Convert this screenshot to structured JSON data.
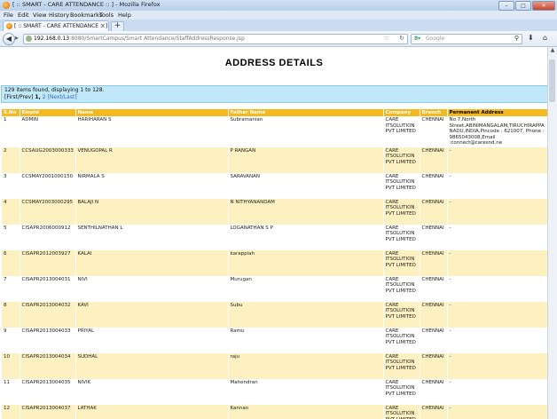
{
  "window": {
    "title": "[ :: SMART - CARE ATTENDANCE :: ] - Mozilla Firefox"
  },
  "menu": [
    "File",
    "Edit",
    "View",
    "History",
    "Bookmarks",
    "Tools",
    "Help"
  ],
  "tab": {
    "label": "[ :: SMART - CARE ATTENDANCE :: ]"
  },
  "address": {
    "host": "192.168.0.13",
    "path": ":8080/SmartCampus/Smart Attendance/StaffAddressResponse.jsp"
  },
  "search": {
    "placeholder": "Google"
  },
  "page": {
    "title": "ADDRESS DETAILS",
    "info_line": "129 items found, displaying 1 to 128.",
    "pager_first": "[First/Prev]",
    "pager_current": "1,",
    "pager_page2": "2",
    "pager_next": "[Next/Last]"
  },
  "table": {
    "headers": [
      "S.No",
      "EmpId",
      "Name",
      "Father Name",
      "Company",
      "Branch",
      "Permanent Address"
    ],
    "rows": [
      {
        "sno": "1",
        "empid": "ADMIN",
        "name": "HARIHARAN S",
        "father": "Subramanian",
        "company": "CARE ITSOLUTION PVT LIMITED",
        "branch": "CHENNAI",
        "address": "No 7,North Street,ABINIMANGALAM,TIRUCHIRAPPA NADU,INDIA,Pincode : 621007, Phone : 9865043008,Email :connect@caresnd.ne"
      },
      {
        "sno": "2",
        "empid": "CCSAUG2003000333",
        "name": "VENUGOPAL R",
        "father": "P RANGAN",
        "company": "CARE ITSOLUTION PVT LIMITED",
        "branch": "CHENNAI",
        "address": "-"
      },
      {
        "sno": "3",
        "empid": "CCSMAY2001000150",
        "name": "NIRMALA S",
        "father": "SARAVANAN",
        "company": "CARE ITSOLUTION PVT LIMITED",
        "branch": "CHENNAI",
        "address": "-"
      },
      {
        "sno": "4",
        "empid": "CCSMAY2003000295",
        "name": "BALAJI N",
        "father": "N NITHYANANDAM",
        "company": "CARE ITSOLUTION PVT LIMITED",
        "branch": "CHENNAI",
        "address": "-"
      },
      {
        "sno": "5",
        "empid": "CISAPR2006000912",
        "name": "SENTHILNATHAN L",
        "father": "LOGANATHAN S P",
        "company": "CARE ITSOLUTION PVT LIMITED",
        "branch": "CHENNAI",
        "address": "-"
      },
      {
        "sno": "6",
        "empid": "CISAPR2012003927",
        "name": "KALAI",
        "father": "karappiah",
        "company": "CARE ITSOLUTION PVT LIMITED",
        "branch": "CHENNAI",
        "address": "-"
      },
      {
        "sno": "7",
        "empid": "CISAPR2013004031",
        "name": "NIVI",
        "father": "Murugan",
        "company": "CARE ITSOLUTION PVT LIMITED",
        "branch": "CHENNAI",
        "address": "-"
      },
      {
        "sno": "8",
        "empid": "CISAPR2013004032",
        "name": "KAVI",
        "father": "Subu",
        "company": "CARE ITSOLUTION PVT LIMITED",
        "branch": "CHENNAI",
        "address": "-"
      },
      {
        "sno": "9",
        "empid": "CISAPR2013004033",
        "name": "PRIYAL",
        "father": "Ramu",
        "company": "CARE ITSOLUTION PVT LIMITED",
        "branch": "CHENNAI",
        "address": "-"
      },
      {
        "sno": "10",
        "empid": "CISAPR2013004034",
        "name": "SUDHAL",
        "father": "raju",
        "company": "CARE ITSOLUTION PVT LIMITED",
        "branch": "CHENNAI",
        "address": "-"
      },
      {
        "sno": "11",
        "empid": "CISAPR2013004035",
        "name": "NIVIK",
        "father": "Mahendran",
        "company": "CARE ITSOLUTION PVT LIMITED",
        "branch": "CHENNAI",
        "address": "-"
      },
      {
        "sno": "12",
        "empid": "CISAPR2013004037",
        "name": "LATHAK",
        "father": "Kannan",
        "company": "CARE ITSOLUTION PVT LIMITED",
        "branch": "CHENNAI",
        "address": "-"
      }
    ]
  },
  "colors": {
    "header_bg": "#f5b81e",
    "row_alt_bg": "#fdf1c2",
    "info_bg": "#c1e8f8",
    "link": "#3366cc"
  }
}
